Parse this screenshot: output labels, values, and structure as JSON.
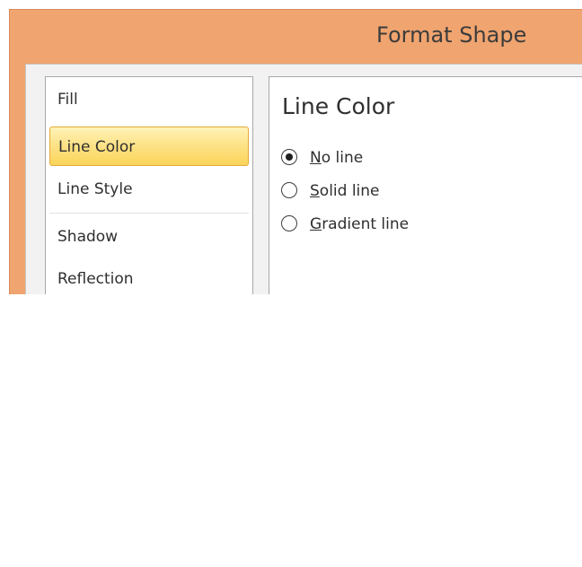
{
  "dialog": {
    "title": "Format Shape"
  },
  "sidebar": {
    "items": [
      {
        "label": "Fill"
      },
      {
        "label": "Line Color"
      },
      {
        "label": "Line Style"
      },
      {
        "label": "Shadow"
      },
      {
        "label": "Reflection"
      }
    ],
    "selected": "Line Color"
  },
  "panel": {
    "title": "Line Color",
    "options": [
      {
        "accel": "N",
        "rest": "o line",
        "selected": true
      },
      {
        "accel": "S",
        "rest": "olid line",
        "selected": false
      },
      {
        "accel": "G",
        "rest": "radient line",
        "selected": false
      }
    ]
  },
  "colors": {
    "title_bar": "#f0a46f",
    "selection": "#fde389"
  }
}
